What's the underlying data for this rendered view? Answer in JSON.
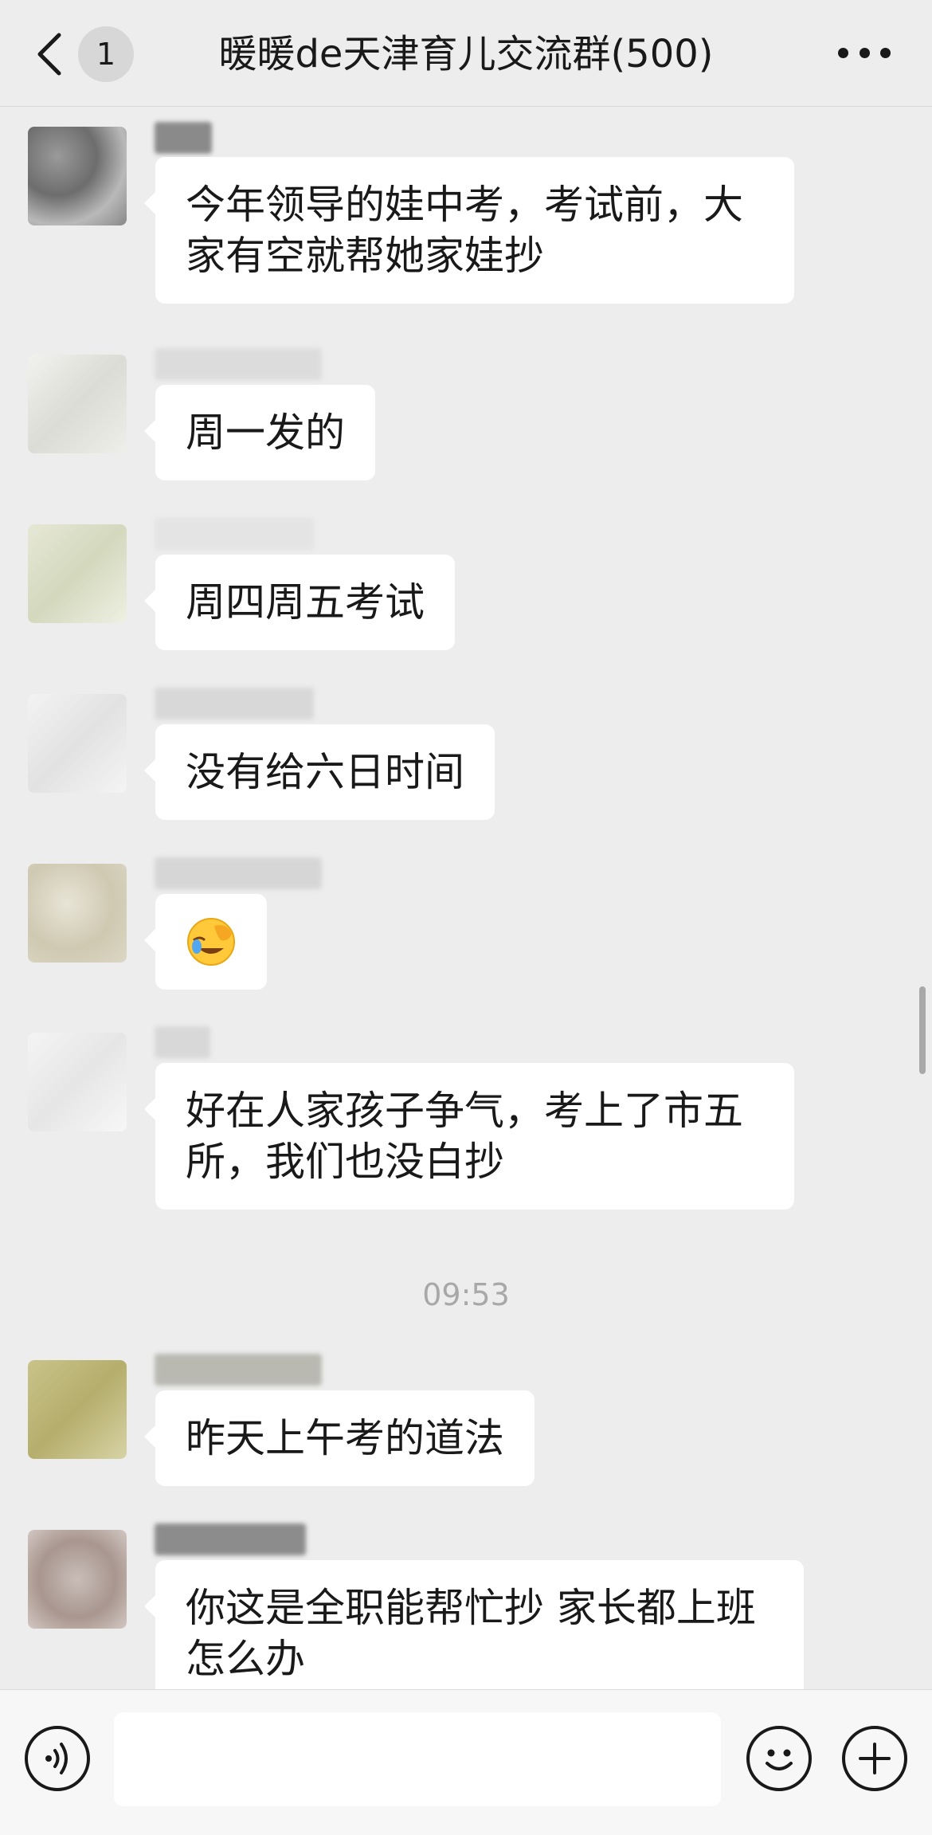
{
  "header": {
    "back_badge": "1",
    "title": "暖暖de天津育儿交流群(500)"
  },
  "messages": [
    {
      "text": "今年领导的娃中考，考试前，大家有空就帮她家娃抄"
    },
    {
      "text": "周一发的"
    },
    {
      "text": "周四周五考试"
    },
    {
      "text": "没有给六日时间"
    },
    {
      "text": "",
      "emoji": "face-palm-laughing-emoji"
    },
    {
      "text": "好在人家孩子争气，考上了市五所，我们也没白抄"
    },
    {
      "text": "昨天上午考的道法"
    },
    {
      "text": "你这是全职能帮忙抄 家长都上班怎么办"
    }
  ],
  "timestamp": "09:53",
  "input": {
    "value": "",
    "placeholder": ""
  },
  "icons": {
    "back": "chevron-left-icon",
    "more": "more-dots-icon",
    "voice": "voice-icon",
    "emoji": "smiley-icon",
    "plus": "plus-icon"
  },
  "colors": {
    "background": "#ededed",
    "bubble": "#ffffff",
    "header_bg": "#ededed",
    "input_bar_bg": "#f7f7f7"
  }
}
